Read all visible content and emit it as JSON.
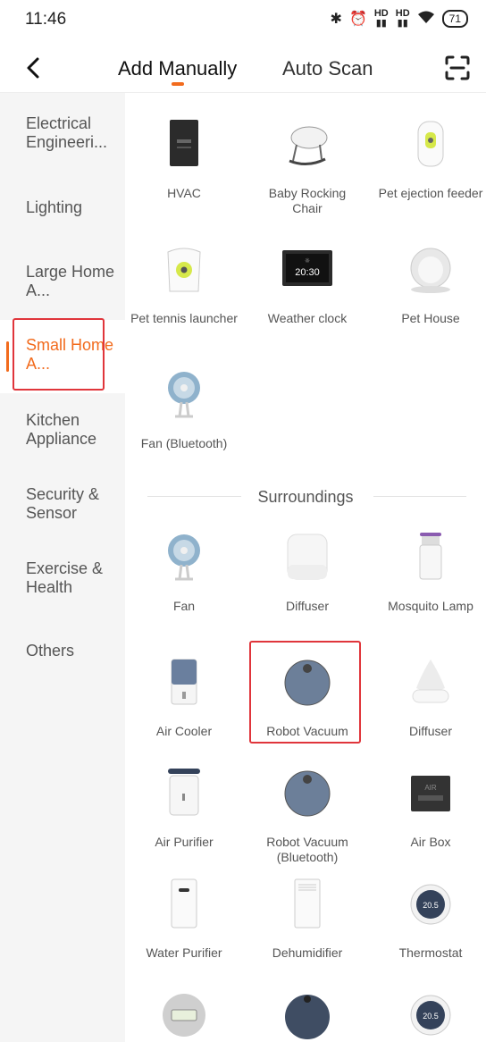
{
  "status": {
    "time": "11:46",
    "battery": "71",
    "hd1": "HD",
    "hd2": "HD"
  },
  "nav": {
    "tab_manual": "Add Manually",
    "tab_scan": "Auto Scan"
  },
  "sidebar": {
    "items": [
      {
        "label": "Electrical Engineeri..."
      },
      {
        "label": "Lighting"
      },
      {
        "label": "Large Home A..."
      },
      {
        "label": "Small Home A..."
      },
      {
        "label": "Kitchen Appliance"
      },
      {
        "label": "Security & Sensor"
      },
      {
        "label": "Exercise & Health"
      },
      {
        "label": "Others"
      }
    ]
  },
  "devices": {
    "hvac": "HVAC",
    "baby_rocking_chair": "Baby Rocking Chair",
    "pet_ejection_feeder": "Pet ejection feeder",
    "pet_tennis_launcher": "Pet tennis launcher",
    "weather_clock": "Weather clock",
    "weather_clock_display": "20:30",
    "pet_house": "Pet House",
    "fan_bluetooth": "Fan (Bluetooth)",
    "fan": "Fan",
    "diffuser_1": "Diffuser",
    "mosquito_lamp": "Mosquito Lamp",
    "air_cooler": "Air Cooler",
    "robot_vacuum": "Robot Vacuum",
    "diffuser_2": "Diffuser",
    "air_purifier": "Air Purifier",
    "robot_vacuum_bluetooth": "Robot Vacuum (Bluetooth)",
    "air_box": "Air Box",
    "air_box_display": "AIR",
    "water_purifier": "Water Purifier",
    "dehumidifier": "Dehumidifier",
    "thermostat": "Thermostat",
    "thermostat_display": "20.5",
    "thermostat_2_display": "20.5"
  },
  "section": {
    "surroundings": "Surroundings"
  },
  "colors": {
    "accent": "#f26b1d",
    "highlight": "#e0353b",
    "sidebar_bg": "#f5f5f5"
  }
}
